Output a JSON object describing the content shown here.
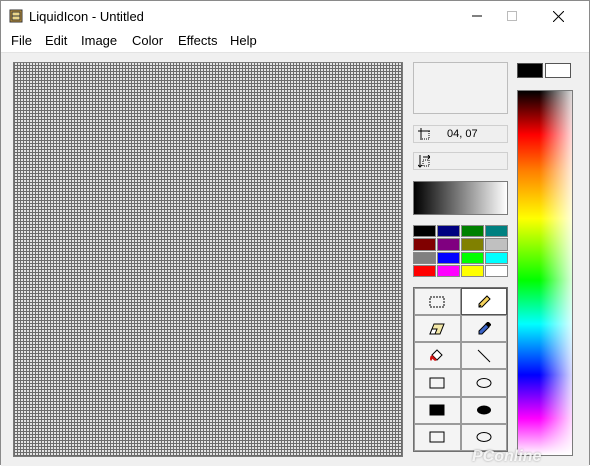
{
  "window": {
    "title": "LiquidIcon - Untitled",
    "controls": {
      "minimize": "–",
      "maximize": "□",
      "close": "✕"
    }
  },
  "menu": [
    "File",
    "Edit",
    "Image",
    "Color",
    "Effects",
    "Help"
  ],
  "status": {
    "coordinates": "04, 07",
    "coordinates_icon": "crosshair-position-icon",
    "size_icon": "selection-size-icon"
  },
  "palette": [
    "#000000",
    "#000080",
    "#008000",
    "#008080",
    "#800000",
    "#800080",
    "#808000",
    "#c0c0c0",
    "#808080",
    "#0000ff",
    "#00ff00",
    "#00ffff",
    "#ff0000",
    "#ff00ff",
    "#ffff00",
    "#ffffff"
  ],
  "tools": [
    {
      "name": "rect-select-tool",
      "icon": "dashed-rectangle-icon",
      "selected": false
    },
    {
      "name": "pencil-tool",
      "icon": "pencil-icon",
      "selected": true
    },
    {
      "name": "eraser-tool",
      "icon": "eraser-icon",
      "selected": false
    },
    {
      "name": "eyedropper-tool",
      "icon": "eyedropper-icon",
      "selected": false
    },
    {
      "name": "fill-tool",
      "icon": "paint-bucket-icon",
      "selected": false
    },
    {
      "name": "line-tool",
      "icon": "line-icon",
      "selected": false
    },
    {
      "name": "rectangle-tool",
      "icon": "rectangle-outline-icon",
      "selected": false
    },
    {
      "name": "ellipse-tool",
      "icon": "ellipse-outline-icon",
      "selected": false
    },
    {
      "name": "filled-rectangle-tool",
      "icon": "filled-rectangle-icon",
      "selected": false
    },
    {
      "name": "filled-ellipse-tool",
      "icon": "filled-ellipse-icon",
      "selected": false
    },
    {
      "name": "rounded-rectangle-tool",
      "icon": "rectangle-outline-icon",
      "selected": false
    },
    {
      "name": "rounded-ellipse-tool",
      "icon": "ellipse-outline-icon",
      "selected": false
    }
  ],
  "current_colors": {
    "foreground": "#000000",
    "background": "#ffffff"
  },
  "watermark": "PConline"
}
